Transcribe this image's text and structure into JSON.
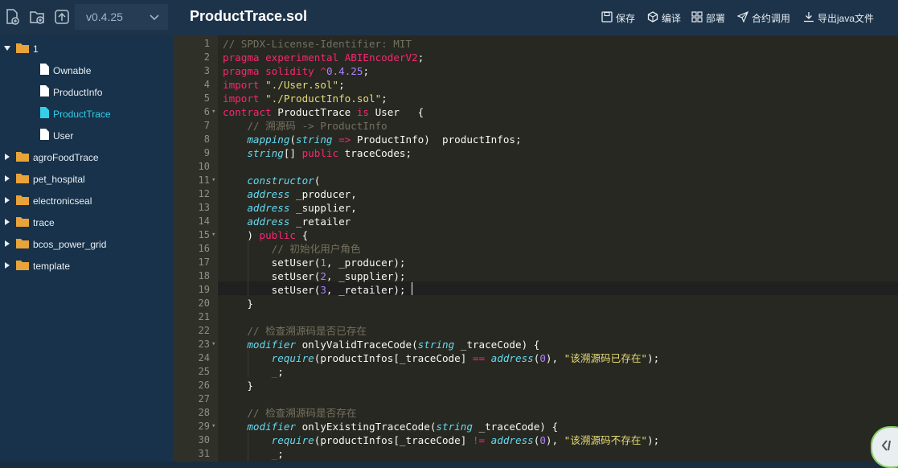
{
  "toolbar": {
    "version": "v0.4.25"
  },
  "tree": [
    {
      "label": "1",
      "type": "folder",
      "expanded": true,
      "level": 0
    },
    {
      "label": "Ownable",
      "type": "file",
      "level": 1
    },
    {
      "label": "ProductInfo",
      "type": "file",
      "level": 1
    },
    {
      "label": "ProductTrace",
      "type": "file",
      "level": 1,
      "active": true
    },
    {
      "label": "User",
      "type": "file",
      "level": 1
    },
    {
      "label": "agroFoodTrace",
      "type": "folder",
      "expanded": false,
      "level": 0
    },
    {
      "label": "pet_hospital",
      "type": "folder",
      "expanded": false,
      "level": 0
    },
    {
      "label": "electronicseal",
      "type": "folder",
      "expanded": false,
      "level": 0
    },
    {
      "label": "trace",
      "type": "folder",
      "expanded": false,
      "level": 0
    },
    {
      "label": "bcos_power_grid",
      "type": "folder",
      "expanded": false,
      "level": 0
    },
    {
      "label": "template",
      "type": "folder",
      "expanded": false,
      "level": 0
    }
  ],
  "header": {
    "file_title": "ProductTrace.sol",
    "actions": [
      {
        "label": "保存",
        "icon": "save-icon"
      },
      {
        "label": "编译",
        "icon": "compile-icon"
      },
      {
        "label": "部署",
        "icon": "deploy-icon"
      },
      {
        "label": "合约调用",
        "icon": "send-icon"
      },
      {
        "label": "导出java文件",
        "icon": "download-icon"
      }
    ]
  },
  "editor": {
    "active_line": 19,
    "fold_lines": [
      6,
      11,
      15,
      23,
      29
    ],
    "lines": [
      "// SPDX-License-Identifier: MIT",
      "pragma experimental ABIEncoderV2;",
      "pragma solidity ^0.4.25;",
      "import \"./User.sol\";",
      "import \"./ProductInfo.sol\";",
      "contract ProductTrace is User   {",
      "    // 溯源码 -> ProductInfo",
      "    mapping(string => ProductInfo)  productInfos;",
      "    string[] public traceCodes;",
      "",
      "    constructor(",
      "    address _producer,",
      "    address _supplier,",
      "    address _retailer",
      "    ) public {",
      "        // 初始化用户角色",
      "        setUser(1, _producer);",
      "        setUser(2, _supplier);",
      "        setUser(3, _retailer);",
      "    }",
      "",
      "    // 检查溯源码是否已存在",
      "    modifier onlyValidTraceCode(string _traceCode) {",
      "        require(productInfos[_traceCode] == address(0), \"该溯源码已存在\");",
      "        _;",
      "    }",
      "",
      "    // 检查溯源码是否存在",
      "    modifier onlyExistingTraceCode(string _traceCode) {",
      "        require(productInfos[_traceCode] != address(0), \"该溯源码不存在\");",
      "        _;"
    ]
  },
  "colors": {
    "sidebar_bg": "#17324a",
    "toolbar_bg": "#1d3349",
    "editor_bg": "#272822",
    "active_file": "#33d0e8"
  }
}
